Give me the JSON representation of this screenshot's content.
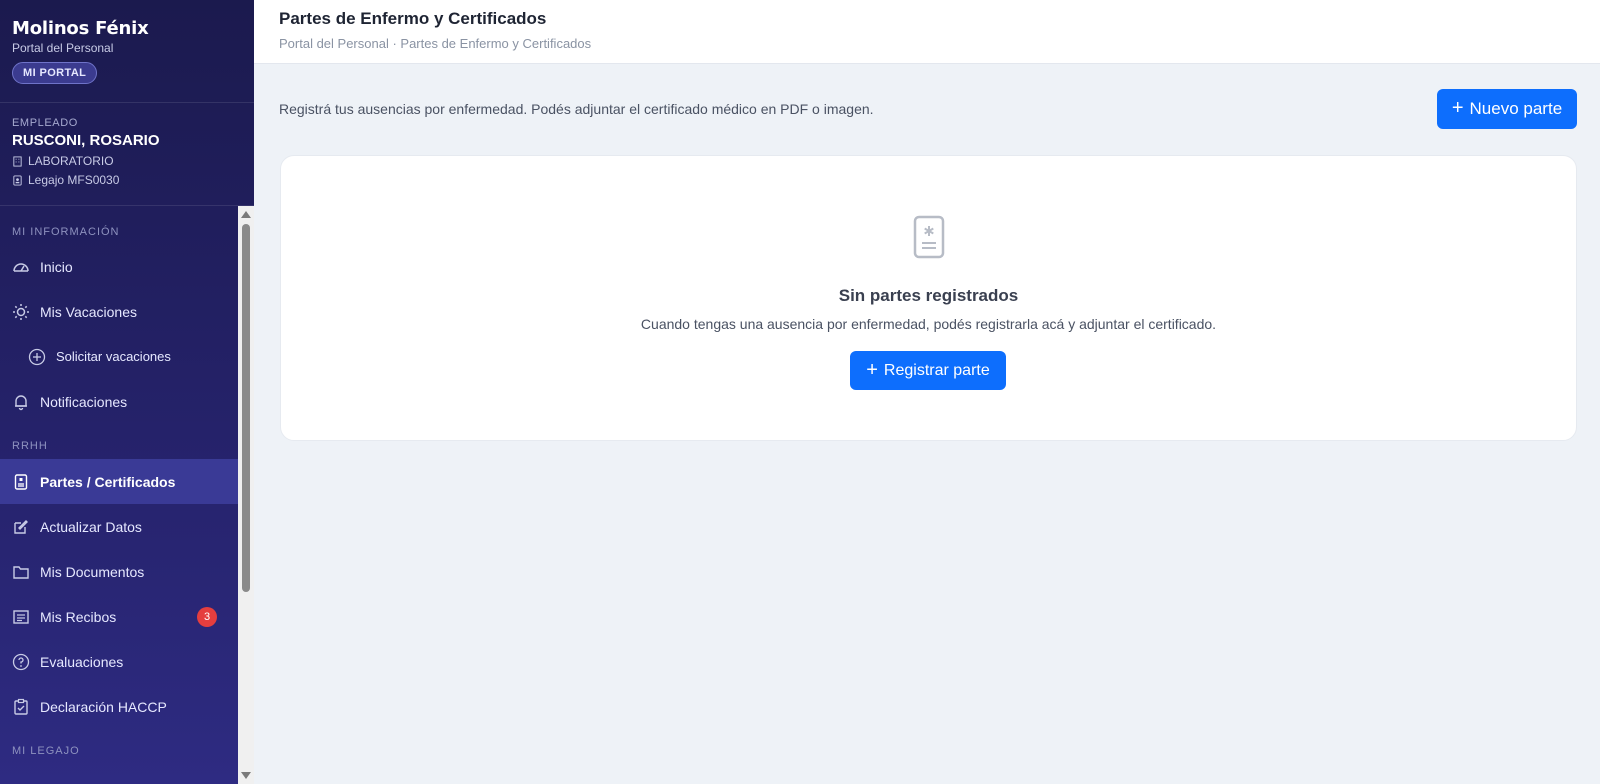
{
  "brand": {
    "title": "Molinos Fénix",
    "subtitle": "Portal del Personal",
    "badge": "MI PORTAL"
  },
  "employee": {
    "label": "EMPLEADO",
    "name": "RUSCONI, ROSARIO",
    "department": "LABORATORIO",
    "legajo": "Legajo MFS0030"
  },
  "sidebar": {
    "sections": [
      {
        "title": "MI INFORMACIÓN"
      },
      {
        "title": "RRHH"
      },
      {
        "title": "MI LEGAJO"
      }
    ],
    "items": [
      {
        "label": "Inicio",
        "icon": "dashboard-icon"
      },
      {
        "label": "Mis Vacaciones",
        "icon": "sun-icon"
      },
      {
        "label": "Solicitar vacaciones",
        "icon": "plus-circle-icon"
      },
      {
        "label": "Notificaciones",
        "icon": "bell-icon"
      },
      {
        "label": "Partes / Certificados",
        "icon": "medical-certificate-icon",
        "active": true
      },
      {
        "label": "Actualizar Datos",
        "icon": "edit-icon"
      },
      {
        "label": "Mis Documentos",
        "icon": "folder-icon"
      },
      {
        "label": "Mis Recibos",
        "icon": "receipt-icon",
        "badge": "3"
      },
      {
        "label": "Evaluaciones",
        "icon": "question-circle-icon"
      },
      {
        "label": "Declaración HACCP",
        "icon": "clipboard-check-icon"
      }
    ]
  },
  "header": {
    "title": "Partes de Enfermo y Certificados",
    "breadcrumb": "Portal del Personal · Partes de Enfermo y Certificados"
  },
  "main": {
    "intro": "Registrá tus ausencias por enfermedad. Podés adjuntar el certificado médico en PDF o imagen.",
    "new_button": "Nuevo parte",
    "empty_title": "Sin partes registrados",
    "empty_desc": "Cuando tengas una ausencia por enfermedad, podés registrarla acá y adjuntar el certificado.",
    "register_button": "Registrar parte"
  },
  "colors": {
    "primary": "#0d6efd",
    "sidebar_bg": "#1b1a4e",
    "sidebar_active": "#3a3a96",
    "badge": "#e53e3e"
  }
}
